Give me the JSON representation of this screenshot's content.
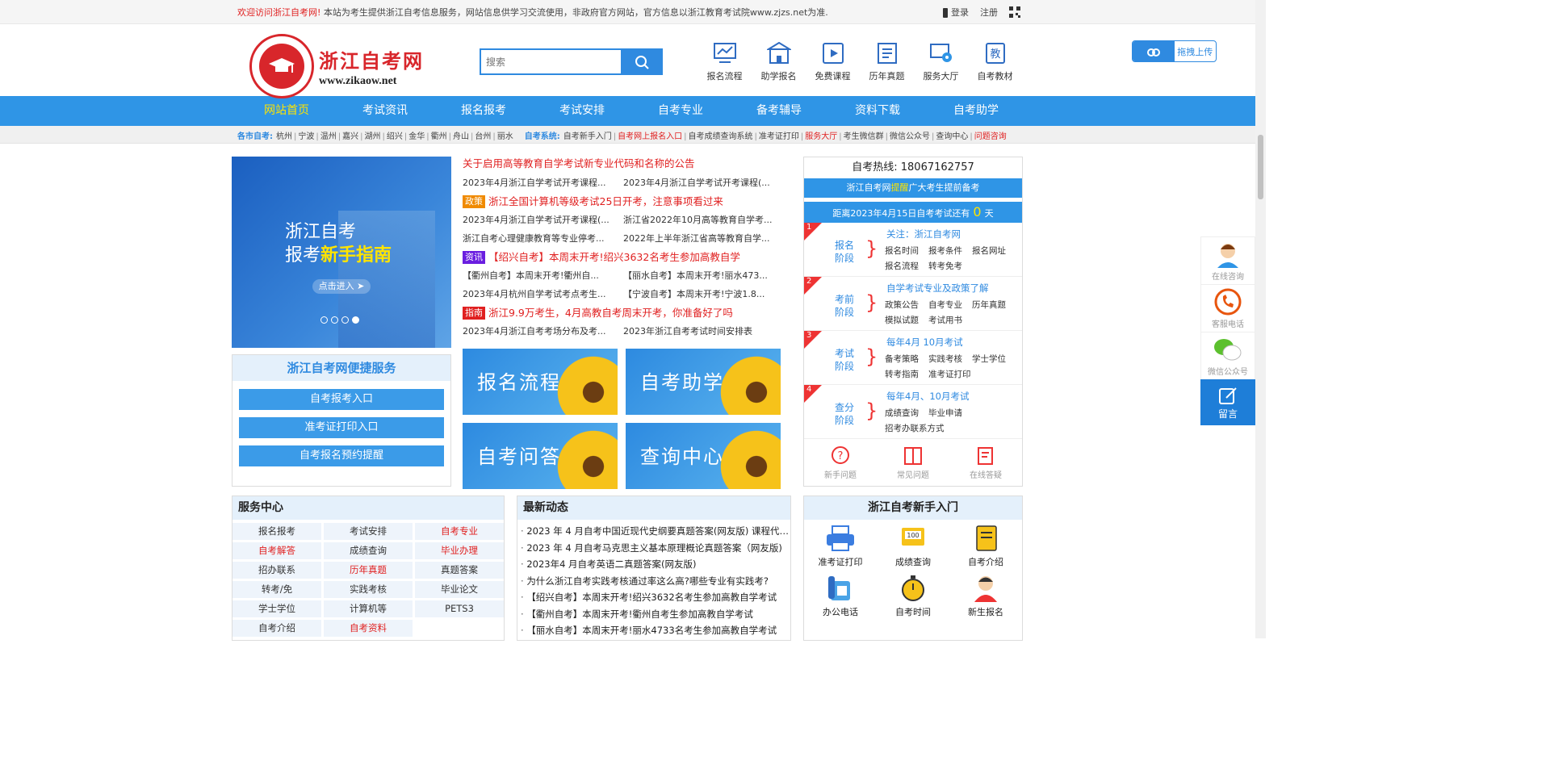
{
  "topbar": {
    "welcome_red": "欢迎访问浙江自考网!",
    "welcome_text": "本站为考生提供浙江自考信息服务，网站信息供学习交流使用，非政府官方网站，官方信息以浙江教育考试院www.zjzs.net为准.",
    "login": "登录",
    "register": "注册"
  },
  "logo": {
    "cn": "浙江自考网",
    "en": "www.zikaow.net"
  },
  "search": {
    "placeholder": "搜索"
  },
  "header_icons": [
    "报名流程",
    "助学报名",
    "免费课程",
    "历年真题",
    "服务大厅",
    "自考教材"
  ],
  "upload": {
    "label": "拖拽上传"
  },
  "nav": [
    "网站首页",
    "考试资讯",
    "报名报考",
    "考试安排",
    "自考专业",
    "备考辅导",
    "资料下载",
    "自考助学"
  ],
  "subbar": {
    "city_label": "各市自考:",
    "cities": [
      "杭州",
      "宁波",
      "温州",
      "嘉兴",
      "湖州",
      "绍兴",
      "金华",
      "衢州",
      "舟山",
      "台州",
      "丽水"
    ],
    "sys_label": "自考系统:",
    "systems": [
      {
        "t": "自考新手入门",
        "red": false
      },
      {
        "t": "自考网上报名入口",
        "red": true
      },
      {
        "t": "自考成绩查询系统",
        "red": false
      },
      {
        "t": "准考证打印",
        "red": false
      },
      {
        "t": "服务大厅",
        "red": true
      },
      {
        "t": "考生微信群",
        "red": false
      },
      {
        "t": "微信公众号",
        "red": false
      },
      {
        "t": "查询中心",
        "red": false
      },
      {
        "t": "问题咨询",
        "red": true
      }
    ]
  },
  "banner": {
    "line1": "浙江自考",
    "line2a": "报考",
    "line2b": "新手指南",
    "enter": "点击进入"
  },
  "quick": {
    "title": "浙江自考网便捷服务",
    "btn1": "自考报考入口",
    "btn2": "准考证打印入口",
    "btn3": "自考报名预约提醒"
  },
  "news": {
    "headline": "关于启用高等教育自学考试新专业代码和名称的公告",
    "r1": [
      "2023年4月浙江自学考试开考课程...",
      "2023年4月浙江自学考试开考课程(..."
    ],
    "hl1": {
      "tag": "政策",
      "text": "浙江全国计算机等级考试25日开考，注意事项看过来"
    },
    "r2": [
      "2023年4月浙江自学考试开考课程(...",
      "浙江省2022年10月高等教育自学考..."
    ],
    "r3": [
      "浙江自考心理健康教育等专业停考...",
      "2022年上半年浙江省高等教育自学..."
    ],
    "hl2": {
      "tag": "资讯",
      "text": "【绍兴自考】本周末开考!绍兴3632名考生参加高教自学"
    },
    "r4": [
      "【衢州自考】本周末开考!衢州自...",
      "【丽水自考】本周末开考!丽水473..."
    ],
    "r5": [
      "2023年4月杭州自学考试考点考生...",
      "【宁波自考】本周末开考!宁波1.8..."
    ],
    "hl3": {
      "tag": "指南",
      "text": "浙江9.9万考生，4月高教自考周末开考，你准备好了吗"
    },
    "r6": [
      "2023年4月浙江自考考场分布及考...",
      "2023年浙江自考考试时间安排表"
    ]
  },
  "tiles": [
    "报名流程",
    "自考助学",
    "自考问答",
    "查询中心"
  ],
  "right": {
    "hotline_label": "自考热线:",
    "hotline": "18067162757",
    "remind_a": "浙江自考网",
    "remind_b": "提醒",
    "remind_c": "广大考生提前备考",
    "count_a": "距离2023年4月15日自考考试还有",
    "count_num": "0",
    "count_unit": "天",
    "stages": [
      {
        "n": "1",
        "name": "报名阶段",
        "title": "关注：浙江自考网",
        "l1": [
          "报名时间",
          "报考条件",
          "报名网址"
        ],
        "l2": [
          "报名流程",
          "转考免考"
        ]
      },
      {
        "n": "2",
        "name": "考前阶段",
        "title": "自学考试专业及政策了解",
        "l1": [
          "政策公告",
          "自考专业",
          "历年真题"
        ],
        "l2": [
          "模拟试题",
          "考试用书"
        ]
      },
      {
        "n": "3",
        "name": "考试阶段",
        "title": "每年4月 10月考试",
        "l1": [
          "备考策略",
          "实践考核",
          "学士学位"
        ],
        "l2": [
          "转考指南",
          "准考证打印"
        ]
      },
      {
        "n": "4",
        "name": "查分阶段",
        "title": "每年4月、10月考试",
        "l1": [
          "成绩查询",
          "毕业申请"
        ],
        "l2": [
          "招考办联系方式"
        ]
      }
    ],
    "helps": [
      "新手问题",
      "常见问题",
      "在线答疑"
    ]
  },
  "service": {
    "title": "服务中心",
    "items": [
      {
        "t": "报名报考",
        "red": false
      },
      {
        "t": "考试安排",
        "red": false
      },
      {
        "t": "自考专业",
        "red": true
      },
      {
        "t": "自考解答",
        "red": true
      },
      {
        "t": "成绩查询",
        "red": false
      },
      {
        "t": "毕业办理",
        "red": true
      },
      {
        "t": "招办联系",
        "red": false
      },
      {
        "t": "历年真题",
        "red": true
      },
      {
        "t": "真题答案",
        "red": false
      },
      {
        "t": "转考/免",
        "red": false
      },
      {
        "t": "实践考核",
        "red": false
      },
      {
        "t": "毕业论文",
        "red": false
      },
      {
        "t": "学士学位",
        "red": false
      },
      {
        "t": "计算机等",
        "red": false
      },
      {
        "t": "PETS3",
        "red": false
      },
      {
        "t": "自考介绍",
        "red": false
      },
      {
        "t": "自考资料",
        "red": true
      }
    ]
  },
  "latest": {
    "title": "最新动态",
    "items": [
      "2023 年 4 月自考中国近现代史纲要真题答案(网友版) 课程代码...",
      "2023 年 4 月自考马克思主义基本原理概论真题答案（网友版)",
      "2023年4 月自考英语二真题答案(网友版)",
      "为什么浙江自考实践考核通过率这么高?哪些专业有实践考?",
      "【绍兴自考】本周末开考!绍兴3632名考生参加高教自学考试",
      "【衢州自考】本周末开考!衢州自考生参加高教自学考试",
      "【丽水自考】本周末开考!丽水4733名考生参加高教自学考试"
    ]
  },
  "intro": {
    "title": "浙江自考新手入门",
    "items": [
      "准考证打印",
      "成绩查询",
      "自考介绍",
      "办公电话",
      "自考时间",
      "新生报名"
    ]
  },
  "float": {
    "consult": "在线咨询",
    "phone": "客服电话",
    "wechat": "微信公众号",
    "msg": "留言"
  }
}
